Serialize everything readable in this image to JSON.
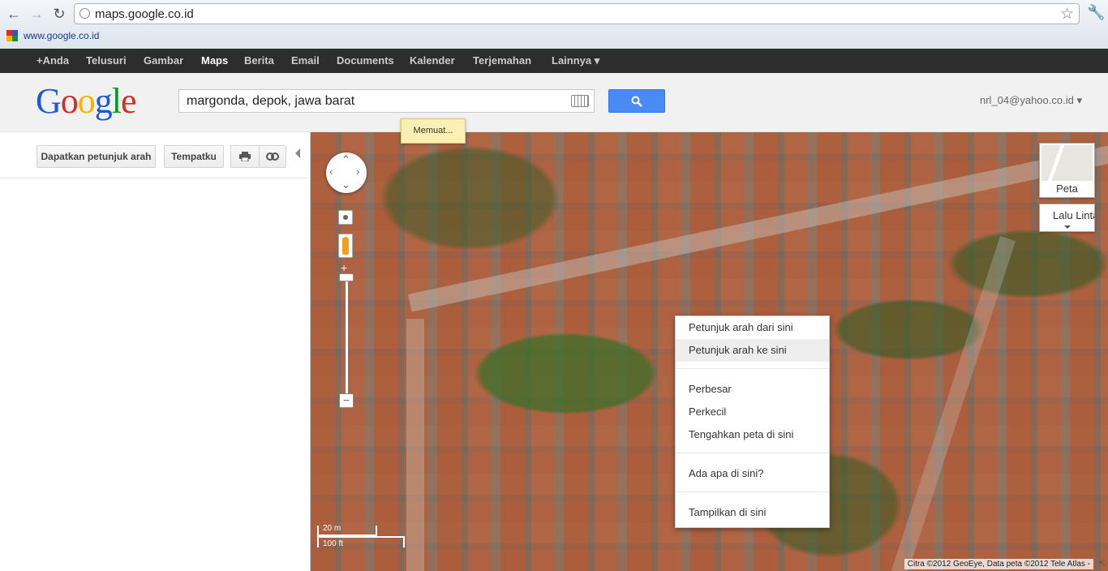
{
  "browser": {
    "url": "maps.google.co.id",
    "bookmark_label": "www.google.co.id",
    "back_icon": "←",
    "forward_icon": "→",
    "reload_icon": "↻",
    "star_icon": "☆",
    "wrench_icon": "🔧"
  },
  "gbar": {
    "items": [
      "+Anda",
      "Telusuri",
      "Gambar",
      "Maps",
      "Berita",
      "Email",
      "Documents",
      "Kalender",
      "Terjemahan",
      "Lainnya ▾"
    ],
    "active": "Maps"
  },
  "header": {
    "logo": [
      "G",
      "o",
      "o",
      "g",
      "l",
      "e"
    ],
    "logo_colors": [
      "#1a5ad8",
      "#d62d20",
      "#f4b400",
      "#1a5ad8",
      "#009925",
      "#d62d20"
    ],
    "search_value": "margonda, depok, jawa barat",
    "account": "nrl_04@yahoo.co.id ▾",
    "search_button_color": "#4a8af4"
  },
  "panel": {
    "directions_button": "Dapatkan petunjuk arah",
    "myplaces_button": "Tempatku",
    "print_icon": "print-icon",
    "link_icon": "link-icon"
  },
  "map": {
    "loading_text": "Memuat...",
    "maptype_label": "Peta",
    "traffic_label": "Lalu Lintas",
    "scale_top": "20 m",
    "scale_bottom": "100 ft",
    "attribution": "Citra ©2012 GeoEye, Data peta ©2012 Tele Atlas -",
    "zoom_plus": "+",
    "zoom_minus": "−"
  },
  "context_menu": {
    "items": [
      "Petunjuk arah dari sini",
      "Petunjuk arah ke sini",
      "Perbesar",
      "Perkecil",
      "Tengahkan peta di sini",
      "Ada apa di sini?",
      "Tampilkan di sini"
    ],
    "hovered_index": 1
  }
}
